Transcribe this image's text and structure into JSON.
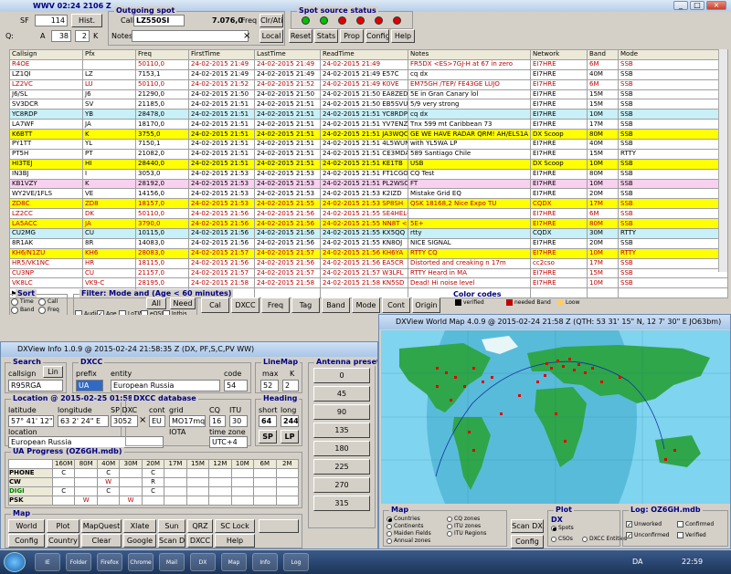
{
  "main_window": {
    "title": "WWV 02:24 2106 Z",
    "sf_label": "SF",
    "sf_value": "114",
    "hist_button": "Hist.",
    "q_label": "Q:",
    "a_label": "A",
    "a_value": "38",
    "k_value": "2",
    "k_label": "K",
    "outgoing": {
      "title": "Outgoing spot",
      "call_label": "Call",
      "call_value": "LZ550SI",
      "freq_value": "7.076,0",
      "freq_label": "Freq",
      "clear_button": "Clr/Ati",
      "notes_label": "Notes",
      "local_button": "Local"
    },
    "status": {
      "title": "Spot source status",
      "leds": [
        "#00c000",
        "#00c000",
        "#e00000",
        "#e00000",
        "#e00000",
        "#e00000"
      ]
    },
    "buttons": {
      "reset": "Reset",
      "stats": "Stats",
      "prop": "Prop",
      "config": "Config",
      "help": "Help"
    },
    "table": {
      "headers": [
        "Callsign",
        "Pfx",
        "Freq",
        "FirstTime",
        "LastTime",
        "ReadTime",
        "Notes",
        "Network",
        "Band",
        "Mode"
      ],
      "rows": [
        {
          "c": [
            "R4OE",
            "",
            "50110,0",
            "24-02-2015 21:49",
            "24-02-2015 21:49",
            "24-02-2015 21:49",
            "FR5DX <ES>7GJ-H at 67 in zero",
            "EI7HRE",
            "6M",
            "SSB"
          ],
          "bg": "#ffffff",
          "fg": "#c00000"
        },
        {
          "c": [
            "LZ1QI",
            "LZ",
            "7153,1",
            "24-02-2015 21:49",
            "24-02-2015 21:49",
            "24-02-2015 21:49 E57C",
            "cq dx",
            "EI7HRE",
            "40M",
            "SSB"
          ],
          "bg": "#ffffff",
          "fg": "#000000"
        },
        {
          "c": [
            "LZ2VC",
            "LU",
            "50110,0",
            "24-02-2015 21:52",
            "24-02-2015 21:52",
            "24-02-2015 21:49 K0VE",
            "EM75GH /TEP/ FE43GE LUJO",
            "EI7HRE",
            "6M",
            "SSB"
          ],
          "bg": "#ffffff",
          "fg": "#c00000"
        },
        {
          "c": [
            "J6/SL",
            "J6",
            "21290,0",
            "24-02-2015 21:50",
            "24-02-2015 21:50",
            "24-02-2015 21:50 EA8ZED",
            "5E in Gran Canary lol",
            "EI7HRE",
            "15M",
            "SSB"
          ],
          "bg": "#ffffff",
          "fg": "#000000"
        },
        {
          "c": [
            "SV3DCR",
            "SV",
            "21185,0",
            "24-02-2015 21:51",
            "24-02-2015 21:51",
            "24-02-2015 21:50 EB5SVU",
            "5/9 very strong",
            "EI7HRE",
            "15M",
            "SSB"
          ],
          "bg": "#ffffff",
          "fg": "#000000"
        },
        {
          "c": [
            "YC8RDP",
            "YB",
            "28478,0",
            "24-02-2015 21:51",
            "24-02-2015 21:51",
            "24-02-2015 21:51 YC8RDP",
            "cq dx",
            "EI7HRE",
            "10M",
            "SSB"
          ],
          "bg": "#c8f0f8",
          "fg": "#000000"
        },
        {
          "c": [
            "LA7WF",
            "JA",
            "18170,0",
            "24-02-2015 21:51",
            "24-02-2015 21:51",
            "24-02-2015 21:51 YV7ENZ",
            "Tnx 599 mt Caribbean 73",
            "EI7HRE",
            "17M",
            "SSB"
          ],
          "bg": "#ffffff",
          "fg": "#000000"
        },
        {
          "c": [
            "K6BTT",
            "K",
            "3755,0",
            "24-02-2015 21:51",
            "24-02-2015 21:51",
            "24-02-2015 21:51 JA3WQC",
            "GE WE HAVE RADAR QRM! AH/ELS1A",
            "DX Scoop",
            "80M",
            "SSB"
          ],
          "bg": "#ffff00",
          "fg": "#000000"
        },
        {
          "c": [
            "PY1TT",
            "YL",
            "7150,1",
            "24-02-2015 21:51",
            "24-02-2015 21:51",
            "24-02-2015 21:51 4L5WUN",
            "with YL5WA LP",
            "EI7HRE",
            "40M",
            "SSB"
          ],
          "bg": "#ffffff",
          "fg": "#000000"
        },
        {
          "c": [
            "PT5H",
            "PT",
            "21082,0",
            "24-02-2015 21:51",
            "24-02-2015 21:51",
            "24-02-2015 21:51 CE3MDA",
            "589 Santiago Chile",
            "EI7HRE",
            "15M",
            "RTTY"
          ],
          "bg": "#ffffff",
          "fg": "#000000"
        },
        {
          "c": [
            "HI3TEJ",
            "HI",
            "28440,0",
            "24-02-2015 21:51",
            "24-02-2015 21:51",
            "24-02-2015 21:51 KE1TB",
            "USB",
            "DX Scoop",
            "10M",
            "SSB"
          ],
          "bg": "#ffff00",
          "fg": "#000000"
        },
        {
          "c": [
            "IN3BJ",
            "I",
            "3053,0",
            "24-02-2015 21:53",
            "24-02-2015 21:53",
            "24-02-2015 21:51 FT1CGO",
            "CQ Test",
            "EI7HRE",
            "80M",
            "SSB"
          ],
          "bg": "#ffffff",
          "fg": "#000000"
        },
        {
          "c": [
            "KB1VZY",
            "K",
            "28192,0",
            "24-02-2015 21:53",
            "24-02-2015 21:53",
            "24-02-2015 21:51 PL2WSC",
            "FT",
            "EI7HRE",
            "10M",
            "SSB"
          ],
          "bg": "#f8d0f0",
          "fg": "#000000"
        },
        {
          "c": [
            "WY2VE/1FLS",
            "VE",
            "14156,0",
            "24-02-2015 21:53",
            "24-02-2015 21:53",
            "24-02-2015 21:53 K2IZD",
            "Mistake Grid EQ",
            "EI7HRE",
            "20M",
            "SSB"
          ],
          "bg": "#ffffff",
          "fg": "#000000"
        },
        {
          "c": [
            "ZD8C",
            "ZD8",
            "18157,0",
            "24-02-2015 21:53",
            "24-02-2015 21:55",
            "24-02-2015 21:53 SP8SH",
            "QSK 18168,2 Nice Expo TU",
            "CQDX",
            "17M",
            "SSB"
          ],
          "bg": "#ffff00",
          "fg": "#c00000"
        },
        {
          "c": [
            "LZ2CC",
            "DK",
            "50110,0",
            "24-02-2015 21:56",
            "24-02-2015 21:56",
            "24-02-2015 21:55 SE4HEL67",
            "",
            "EI7HRE",
            "6M",
            "SSB"
          ],
          "bg": "#ffffff",
          "fg": "#c00000"
        },
        {
          "c": [
            "LA5ACC",
            "JA",
            "3790,0",
            "24-02-2015 21:56",
            "24-02-2015 21:56",
            "24-02-2015 21:55 NN8T <E>",
            "5E+",
            "EI7HRE",
            "80M",
            "SSB"
          ],
          "bg": "#ffff00",
          "fg": "#c00000"
        },
        {
          "c": [
            "CU2MG",
            "CU",
            "10115,0",
            "24-02-2015 21:56",
            "24-02-2015 21:56",
            "24-02-2015 21:55 KX5QQ <E>",
            "rtty",
            "CQDX",
            "30M",
            "RTTY"
          ],
          "bg": "#c8f0f8",
          "fg": "#000000"
        },
        {
          "c": [
            "8R1AK",
            "8R",
            "14083,0",
            "24-02-2015 21:56",
            "24-02-2015 21:56",
            "24-02-2015 21:55 KN8OJ",
            "NICE SIGNAL",
            "EI7HRE",
            "20M",
            "SSB"
          ],
          "bg": "#ffffff",
          "fg": "#000000"
        },
        {
          "c": [
            "KH6/N1ZU",
            "KH6",
            "28083,0",
            "24-02-2015 21:57",
            "24-02-2015 21:57",
            "24-02-2015 21:56 KH6YA",
            "RTTY CQ",
            "EI7HRE",
            "10M",
            "RTTY"
          ],
          "bg": "#ffff00",
          "fg": "#c00000"
        },
        {
          "c": [
            "HR5/VK1NC",
            "HR",
            "18115,0",
            "24-02-2015 21:56",
            "24-02-2015 21:56",
            "24-02-2015 21:56 EA5CR",
            "Distorted and creaking n 17m",
            "cc2cso",
            "17M",
            "SSB"
          ],
          "bg": "#ffffff",
          "fg": "#c00000"
        },
        {
          "c": [
            "CU3NP",
            "CU",
            "21157,0",
            "24-02-2015 21:57",
            "24-02-2015 21:57",
            "24-02-2015 21:57 W3LFL",
            "RTTY Heard in MA",
            "EI7HRE",
            "15M",
            "SSB"
          ],
          "bg": "#ffffff",
          "fg": "#c00000"
        },
        {
          "c": [
            "VK8LC",
            "VK9-C",
            "28195,0",
            "24-02-2015 21:58",
            "24-02-2015 21:58",
            "24-02-2015 21:58 KN5SD",
            "Dead! Hi noise level",
            "EI7HRE",
            "10M",
            "SSB"
          ],
          "bg": "#ffffff",
          "fg": "#c00000"
        }
      ]
    },
    "sort": {
      "title": "Sort",
      "options": [
        "Time",
        "Call",
        "Band",
        "Freq",
        "Net",
        "Asc",
        "Dsc"
      ]
    },
    "filter": {
      "title": "Filter: Mode and (Age < 60 minutes)",
      "items": [
        "Audio",
        "Age",
        "LoTW",
        "eQSL",
        "Inthis"
      ],
      "all_label": "All",
      "need_button": "Need",
      "sql": [
        "SQL 1",
        "SQL 2",
        "SQL 3",
        "SQL 4",
        "SQL 5"
      ]
    },
    "mid_buttons": [
      "Cal",
      "DXCC",
      "Freq",
      "Tag",
      "Band",
      "Mode",
      "Cont",
      "Origin"
    ],
    "color_codes": {
      "title": "Color codes",
      "items": [
        {
          "label": "verified",
          "color": "#000000"
        },
        {
          "label": "needed Band",
          "color": "#c00000"
        },
        {
          "label": "Loow",
          "color": "#ffcc66"
        }
      ]
    }
  },
  "info_window": {
    "title": "DXView Info 1.0.9 @ 2015-02-24 21:58:35 Z (DX, PF,S,C,PV WW)",
    "search": {
      "title": "Search",
      "callsign_label": "callsign",
      "callsign_value": "R95RGA",
      "lin_button": "Lin"
    },
    "dxcc": {
      "title": "DXCC",
      "prefix_label": "prefix",
      "prefix_value": "UA",
      "entity_label": "entity",
      "entity_value": "European Russia",
      "code_label": "code",
      "code_value": "54"
    },
    "lineup": {
      "title": "LineMap",
      "max_label": "max",
      "k_label": "K",
      "max_value": "52",
      "k_value": "2"
    },
    "location": {
      "title": "Location @ 2015-02-25 01:58:35 local",
      "lat_label": "latitude",
      "lat_value": "57° 41' 12\" N",
      "lon_label": "longitude",
      "lon_value": "63 2' 24\" E",
      "location_label": "location",
      "location_value": "European Russia"
    },
    "dxcc_db": {
      "title": "DXCC database",
      "sp_label": "SP DXC",
      "sp_value": "3052",
      "cont_label": "cont",
      "cont_value": "EU",
      "grid_label": "grid",
      "grid_value": "MO17mq",
      "cq_label": "CQ",
      "cq_value": "16",
      "itu_label": "ITU",
      "itu_value": "30",
      "iota_label": "IOTA",
      "tz_label": "time zone",
      "tz_value": "UTC+4"
    },
    "heading": {
      "title": "Heading",
      "short_label": "short",
      "long_label": "long",
      "short_value": "64",
      "long_value": "244",
      "sp_button": "SP",
      "lp_button": "LP"
    },
    "antenna": {
      "title": "Antenna presets",
      "presets": [
        "0",
        "45",
        "90",
        "135",
        "180",
        "225",
        "270",
        "315"
      ]
    },
    "progress": {
      "title": "UA Progress (OZ6GH.mdb)",
      "bands": [
        "160M",
        "80M",
        "40M",
        "30M",
        "20M",
        "17M",
        "15M",
        "12M",
        "10M",
        "6M",
        "2M"
      ],
      "rows": [
        {
          "mode": "PHONE",
          "vals": [
            "C",
            "",
            "C",
            "",
            "C",
            "",
            "",
            "",
            "",
            "",
            ""
          ]
        },
        {
          "mode": "CW",
          "vals": [
            "",
            "",
            "W",
            "",
            "R",
            "",
            "",
            "",
            "",
            "",
            ""
          ]
        },
        {
          "mode": "DIGI",
          "vals": [
            "C",
            "",
            "C",
            "",
            "C",
            "",
            "",
            "",
            "",
            "",
            ""
          ]
        },
        {
          "mode": "PSK",
          "vals": [
            "",
            "W",
            "",
            "W",
            "",
            "",
            "",
            "",
            "",
            "",
            ""
          ]
        }
      ]
    },
    "map": {
      "title": "Map",
      "buttons": [
        "World",
        "Plot",
        "MapQuest",
        "Xlate",
        "Sun",
        "QRZ",
        "SC Lock",
        "Config",
        "Country",
        "Clear",
        "Google",
        "Scan DX",
        "DXCC",
        "Help"
      ]
    }
  },
  "map_window": {
    "title": "DXView World Map 4.0.9 @ 2015-02-24 21:58 Z (QTH: 53 31' 15\" N, 12 7' 30\" E JO63bm)",
    "map_options": {
      "title": "Map",
      "options": [
        "Countries",
        "Continents",
        "Maiden Fields",
        "Annual zones",
        "CQ zones",
        "ITU zones",
        "ITU Regions"
      ]
    },
    "scan_button": "Scan DX",
    "config_button": "Config",
    "plot": {
      "title": "Plot",
      "dx_label": "DX",
      "items": [
        "Spots",
        "CSOs",
        "DXCC Entities"
      ]
    },
    "log": {
      "title": "Log: OZ6GH.mdb",
      "items": [
        "Unworked",
        "Unconfirmed",
        "Confirmed",
        "Verified"
      ]
    }
  },
  "taskbar": {
    "icons": [
      "IE",
      "Folder",
      "Firefox",
      "Chrome",
      "Mail",
      "DX",
      "Map",
      "Info",
      "Log"
    ],
    "clock": "22:59",
    "lang": "DA"
  }
}
